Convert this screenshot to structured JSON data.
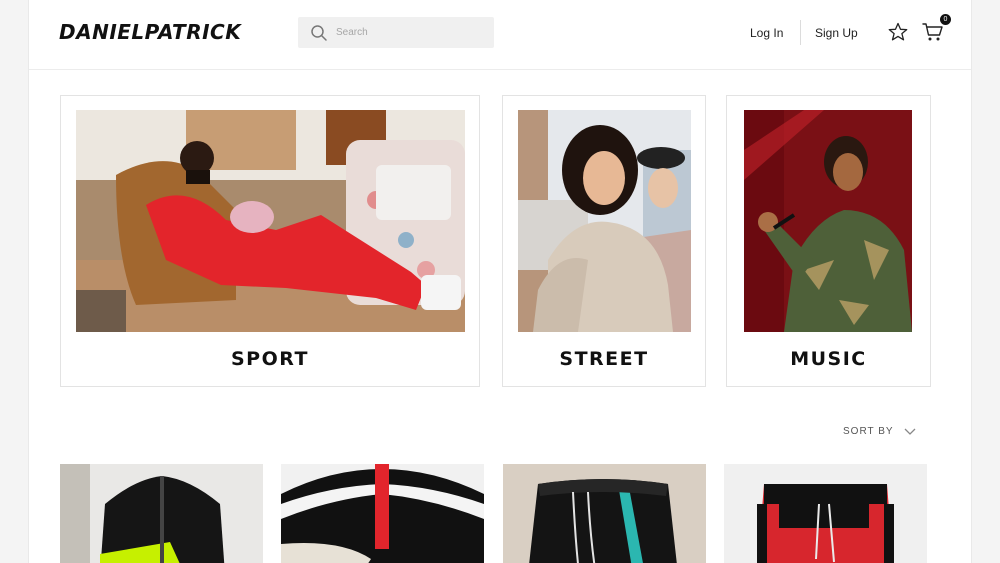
{
  "brand": {
    "logo": "DANIELPATRICK"
  },
  "search": {
    "placeholder": "Search"
  },
  "nav": {
    "login": "Log In",
    "signup": "Sign Up",
    "cart_count": "0"
  },
  "categories": [
    {
      "label": "SPORT"
    },
    {
      "label": "STREET"
    },
    {
      "label": "MUSIC"
    }
  ],
  "sort": {
    "label": "SORT BY"
  },
  "colors": {
    "accent_red": "#d7262d",
    "text": "#111111",
    "neon": "#c6f000",
    "teal": "#2bb7b0"
  },
  "icons": [
    "search-icon",
    "star-icon",
    "cart-icon",
    "chevron-down-icon"
  ]
}
